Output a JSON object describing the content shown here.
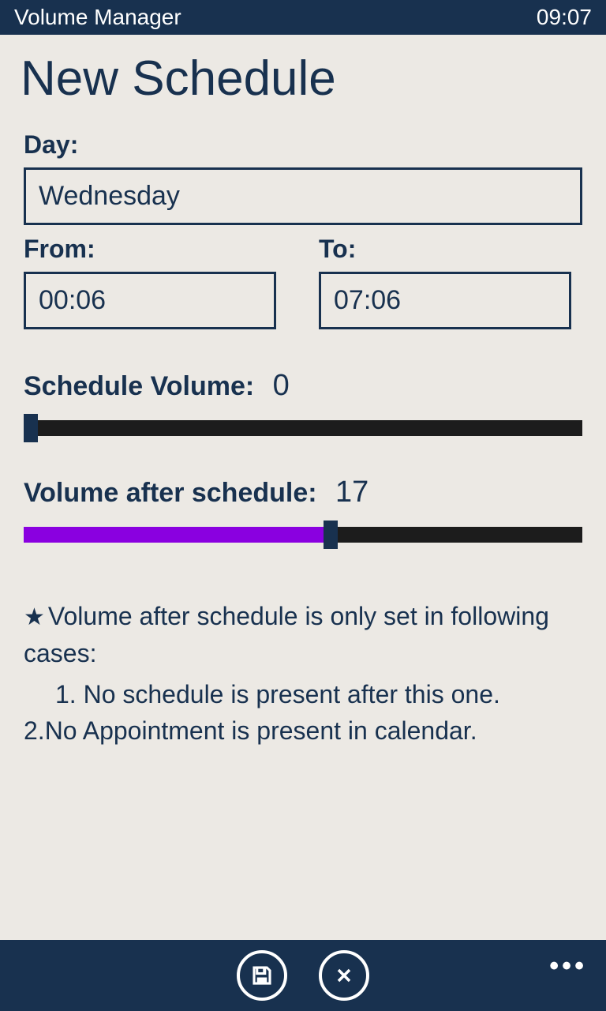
{
  "status_bar": {
    "app_name": "Volume Manager",
    "clock": "09:07"
  },
  "page": {
    "title": "New Schedule"
  },
  "form": {
    "day_label": "Day:",
    "day_value": "Wednesday",
    "from_label": "From:",
    "from_value": "00:06",
    "to_label": "To:",
    "to_value": "07:06"
  },
  "sliders": {
    "schedule_vol": {
      "label": "Schedule Volume:",
      "value": "0",
      "percent": 0
    },
    "after_vol": {
      "label": "Volume after schedule:",
      "value": "17",
      "percent": 55
    }
  },
  "notes": {
    "star": "★",
    "header": "Volume after schedule is only set in following cases:",
    "line1_num": "1.",
    "line1": "No schedule is present after this one.",
    "line2_num": "2.",
    "line2": "No Appointment is present in calendar."
  },
  "bottombar": {
    "save": "save",
    "cancel": "cancel",
    "more": "•••"
  }
}
